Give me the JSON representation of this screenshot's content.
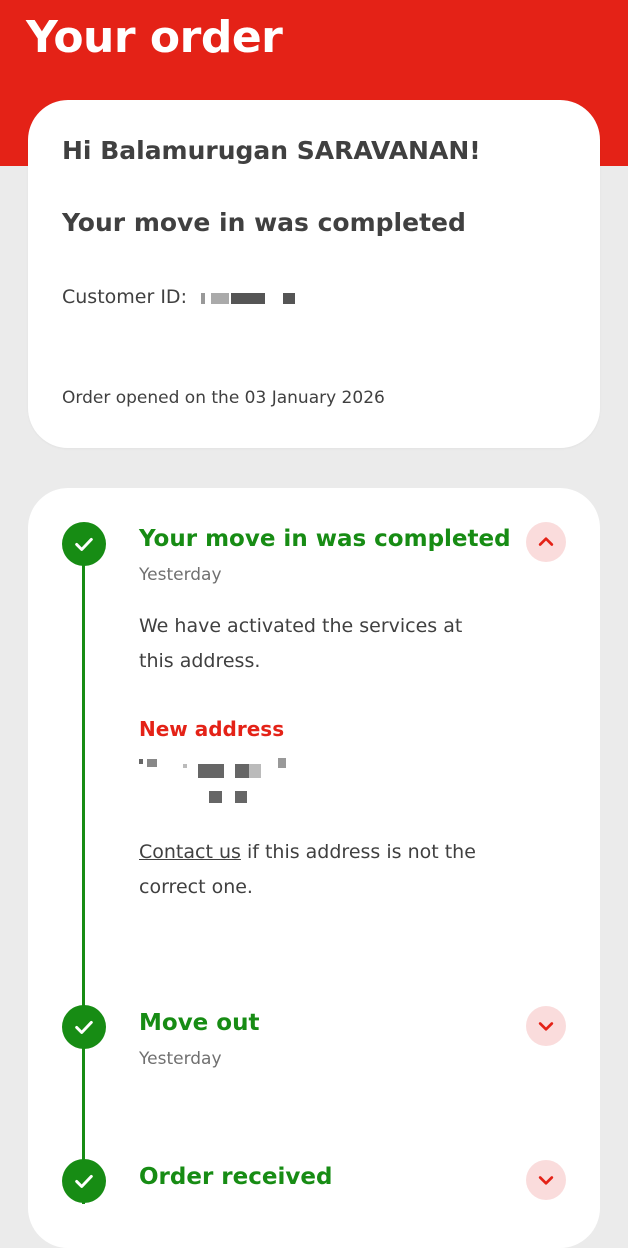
{
  "header": {
    "title": "Your order"
  },
  "summary": {
    "greeting": "Hi Balamurugan SARAVANAN!",
    "status": "Your move in was completed",
    "customer_id_label": "Customer ID:",
    "order_opened": "Order opened on the 03 January 2026"
  },
  "timeline": {
    "steps": [
      {
        "title": "Your move in was completed",
        "time": "Yesterday",
        "expanded": true,
        "description": "We have activated the services at this address.",
        "address_label": "New address",
        "contact_link": "Contact us",
        "contact_rest": " if this address is not the correct one."
      },
      {
        "title": "Move out",
        "time": "Yesterday",
        "expanded": false
      },
      {
        "title": "Order received",
        "expanded": false
      }
    ]
  },
  "colors": {
    "brand_red": "#e42217",
    "success_green": "#178c14",
    "toggle_bg": "#fadcdc",
    "text": "#404040"
  },
  "icons": {
    "step_status": "checkmark-icon",
    "expand": "chevron-down-icon",
    "collapse": "chevron-up-icon"
  }
}
